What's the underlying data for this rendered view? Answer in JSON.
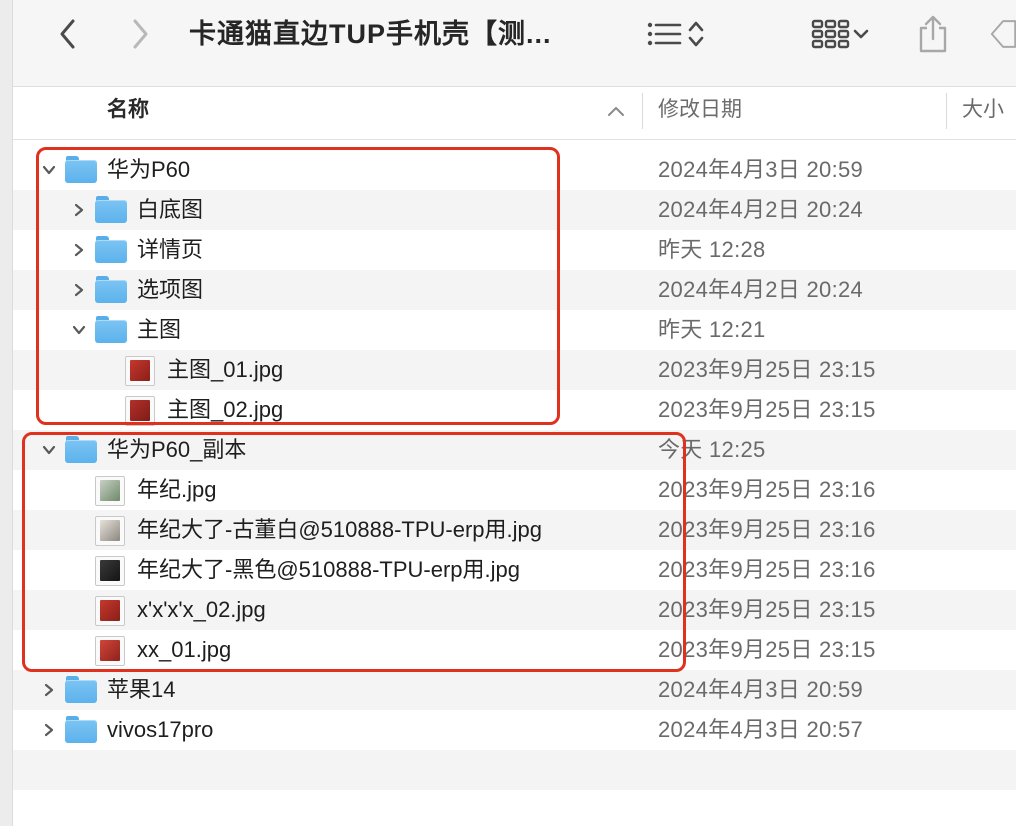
{
  "toolbar": {
    "title": "卡通猫直边TUP手机壳【测..."
  },
  "columns": {
    "name": "名称",
    "modified": "修改日期",
    "size": "大小"
  },
  "rows": [
    {
      "name": "华为P60",
      "date": "2024年4月3日 20:59",
      "kind": "folder",
      "expanded": true,
      "depth": 0
    },
    {
      "name": "白底图",
      "date": "2024年4月2日 20:24",
      "kind": "folder",
      "expanded": false,
      "depth": 1
    },
    {
      "name": "详情页",
      "date": "昨天 12:28",
      "kind": "folder",
      "expanded": false,
      "depth": 1
    },
    {
      "name": "选项图",
      "date": "2024年4月2日 20:24",
      "kind": "folder",
      "expanded": false,
      "depth": 1
    },
    {
      "name": "主图",
      "date": "昨天 12:21",
      "kind": "folder",
      "expanded": true,
      "depth": 1
    },
    {
      "name": "主图_01.jpg",
      "date": "2023年9月25日 23:15",
      "kind": "image",
      "depth": 2
    },
    {
      "name": "主图_02.jpg",
      "date": "2023年9月25日 23:15",
      "kind": "image",
      "depth": 2
    },
    {
      "name": "华为P60_副本",
      "date": "今天 12:25",
      "kind": "folder",
      "expanded": true,
      "depth": 0
    },
    {
      "name": "年纪.jpg",
      "date": "2023年9月25日 23:16",
      "kind": "image",
      "depth": 1
    },
    {
      "name": "年纪大了-古董白@510888-TPU-erp用.jpg",
      "date": "2023年9月25日 23:16",
      "kind": "image",
      "depth": 1
    },
    {
      "name": "年纪大了-黑色@510888-TPU-erp用.jpg",
      "date": "2023年9月25日 23:16",
      "kind": "image",
      "depth": 1
    },
    {
      "name": "x'x'x'x_02.jpg",
      "date": "2023年9月25日 23:15",
      "kind": "image",
      "depth": 1
    },
    {
      "name": "xx_01.jpg",
      "date": "2023年9月25日 23:15",
      "kind": "image",
      "depth": 1
    },
    {
      "name": "苹果14",
      "date": "2024年4月3日 20:59",
      "kind": "folder",
      "expanded": false,
      "depth": 0
    },
    {
      "name": "vivos17pro",
      "date": "2024年4月3日 20:57",
      "kind": "folder",
      "expanded": false,
      "depth": 0
    }
  ],
  "icons": {
    "back": "chevron-left-icon",
    "forward": "chevron-right-icon",
    "list_view": "list-view-icon",
    "sort": "sort-updown-icon",
    "grid_view": "grid-view-icon",
    "share": "share-icon",
    "tag": "tag-icon"
  },
  "colors": {
    "folder": "#6ab9f0",
    "highlight_box": "#e0311f",
    "alt_row": "#f4f4f4"
  }
}
